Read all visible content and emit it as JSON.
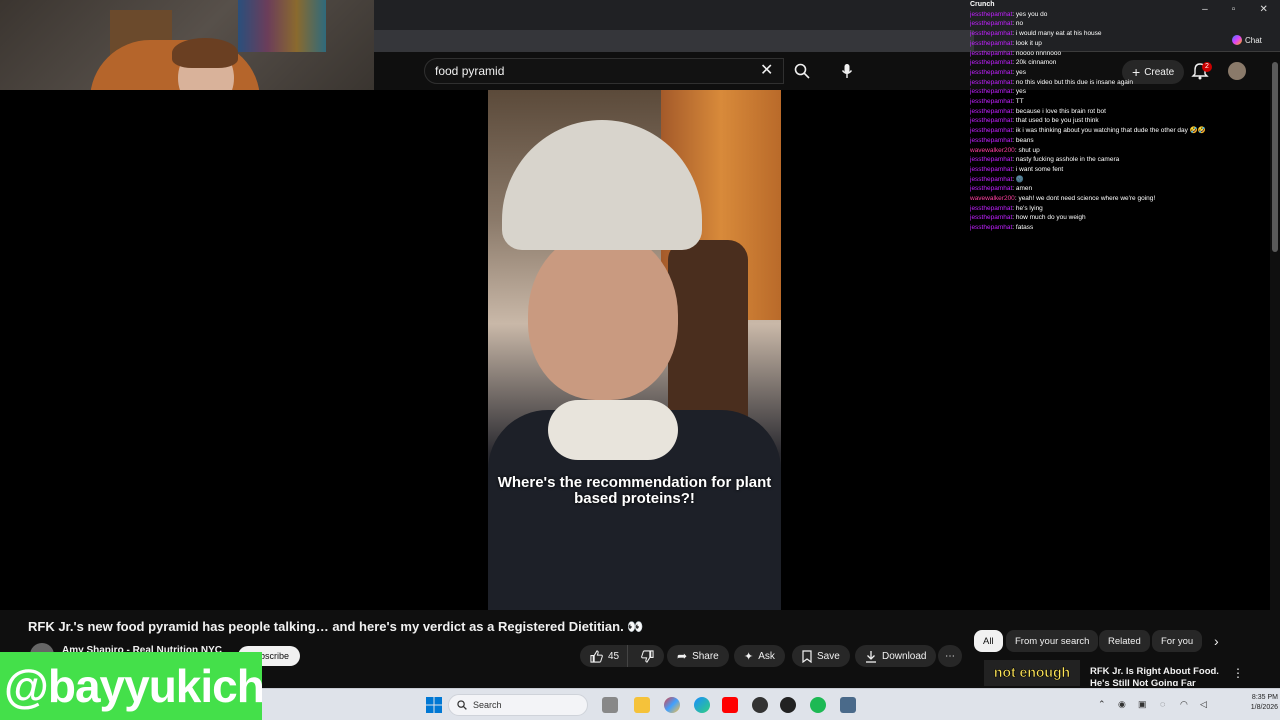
{
  "search": {
    "query": "food pyramid"
  },
  "header": {
    "create_label": "Create",
    "notification_count": "2"
  },
  "video": {
    "caption": "Where's the recommendation for plant based proteins?!"
  },
  "title": "RFK Jr.'s new food pyramid has people talking… and here's my verdict as a Registered Dietitian. 👀",
  "channel": {
    "name": "Amy Shapiro - Real Nutrition NYC",
    "subscribe_label": "Subscribe"
  },
  "actions": {
    "like_count": "45",
    "share_label": "Share",
    "ask_label": "Ask",
    "save_label": "Save",
    "download_label": "Download"
  },
  "chips": [
    "All",
    "From your search",
    "Related",
    "For you"
  ],
  "recommended": {
    "thumb_text": "not enough",
    "title": "RFK Jr. Is Right About Food. He's Still Not Going Far Enough"
  },
  "chat": {
    "title": "Crunch",
    "messages": [
      {
        "user": "jessthepamhat",
        "text": "yes you do"
      },
      {
        "user": "jessthepamhat",
        "text": "no"
      },
      {
        "user": "jessthepamhat",
        "text": "i would many eat at his house"
      },
      {
        "user": "jessthepamhat",
        "text": "look it up"
      },
      {
        "user": "jessthepamhat",
        "text": "noooo nnnnooo"
      },
      {
        "user": "jessthepamhat",
        "text": "20k cinnamon"
      },
      {
        "user": "jessthepamhat",
        "text": "yes"
      },
      {
        "user": "jessthepamhat",
        "text": "no this video but this due is insane again"
      },
      {
        "user": "jessthepamhat",
        "text": "yes"
      },
      {
        "user": "jessthepamhat",
        "text": "TT"
      },
      {
        "user": "jessthepamhat",
        "text": "because i love this brain rot bot"
      },
      {
        "user": "jessthepamhat",
        "text": "that used to be you just think"
      },
      {
        "user": "jessthepamhat",
        "text": "ik i was thinking about you watching that dude the other day 🤣🤣"
      },
      {
        "user": "jessthepamhat",
        "text": "beans"
      },
      {
        "user": "wavewalker200",
        "text": "shut up"
      },
      {
        "user": "jessthepamhat",
        "text": "nasty fucking asshole in the camera"
      },
      {
        "user": "jessthepamhat",
        "text": "i want some fent"
      },
      {
        "user": "jessthepamhat",
        "text": "🌚"
      },
      {
        "user": "jessthepamhat",
        "text": "amen"
      },
      {
        "user": "wavewalker200",
        "text": "yeah! we dont need science where we're going!"
      },
      {
        "user": "jessthepamhat",
        "text": "he's lying"
      },
      {
        "user": "jessthepamhat",
        "text": "how much do you weigh"
      },
      {
        "user": "jessthepamhat",
        "text": "fatass"
      }
    ]
  },
  "browser": {
    "chat_button": "Chat"
  },
  "overlay": {
    "username": "@bayyukich"
  },
  "taskbar": {
    "search_label": "Search",
    "time": "8:35 PM",
    "date": "1/8/2026"
  },
  "colors": {
    "username_bg": "#44e04a",
    "chat_user": "#c020ff",
    "yt_bg": "#0f0f0f"
  }
}
